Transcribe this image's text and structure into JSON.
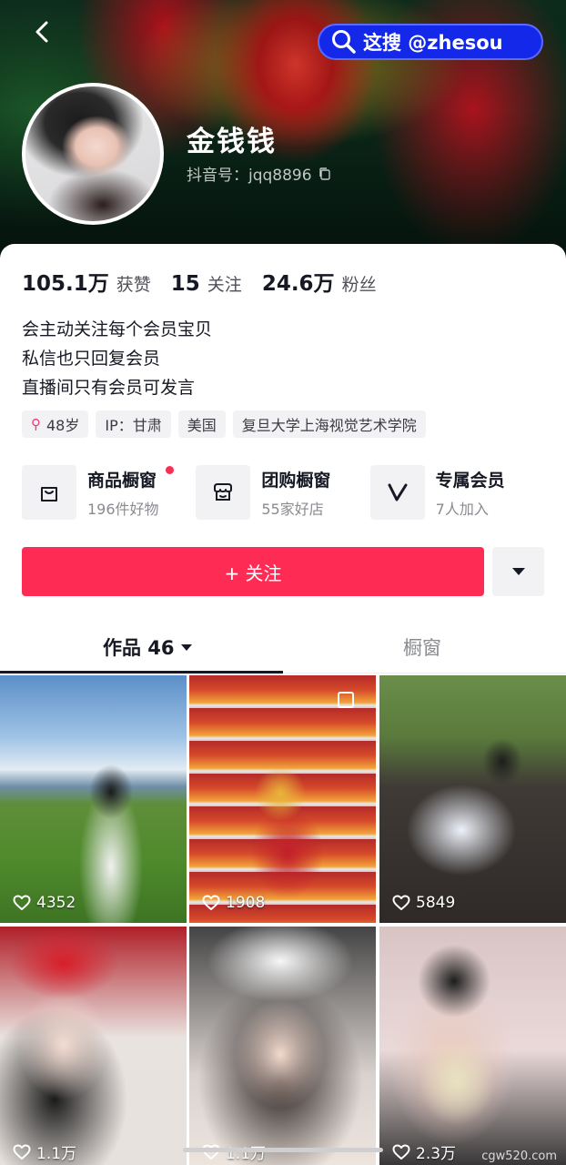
{
  "header": {
    "nickname": "金钱钱",
    "douyin_id": "抖音号：jqq8896",
    "watermark": "这搜 @zhesou"
  },
  "stats": [
    {
      "value": "105.1万",
      "label": "获赞"
    },
    {
      "value": "15",
      "label": "关注"
    },
    {
      "value": "24.6万",
      "label": "粉丝"
    }
  ],
  "bio": {
    "line1": "会主动关注每个会员宝贝",
    "line2": "私信也只回复会员",
    "line3": "直播间只有会员可发言"
  },
  "tags": {
    "age": "48岁",
    "ip": "IP：甘肃",
    "country": "美国",
    "school": "复旦大学上海视觉艺术学院"
  },
  "features": [
    {
      "title": "商品橱窗",
      "sub": "196件好物",
      "icon": "shopping-bag-icon"
    },
    {
      "title": "团购橱窗",
      "sub": "55家好店",
      "icon": "store-icon"
    },
    {
      "title": "专属会员",
      "sub": "7人加入",
      "icon": "vip-v-icon"
    }
  ],
  "actions": {
    "follow_label": "+ 关注"
  },
  "tabs": {
    "works": "作品 46",
    "shop": "橱窗"
  },
  "videos": [
    {
      "likes": "4352"
    },
    {
      "likes": "1908"
    },
    {
      "likes": "5849"
    },
    {
      "likes": "1.1万"
    },
    {
      "likes": "1.1万"
    },
    {
      "likes": "2.3万"
    }
  ],
  "site_watermark": "cgw520.com",
  "colors": {
    "accent": "#fe2c55",
    "watermark_badge": "#1328e8"
  }
}
